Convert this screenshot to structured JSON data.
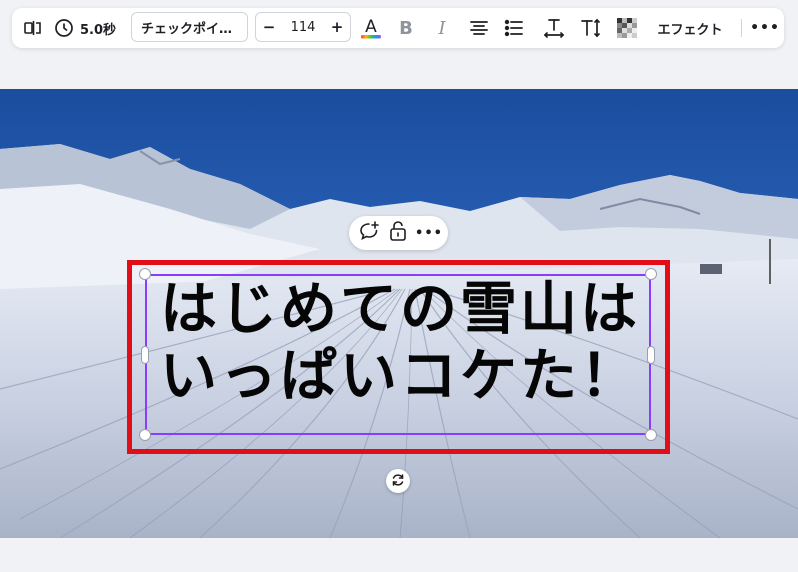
{
  "toolbar": {
    "duration_label": "5.0秒",
    "font_name": "チェックポイ…",
    "font_size": "114",
    "decrease_label": "−",
    "increase_label": "+",
    "text_color_glyph": "A",
    "bold_glyph": "B",
    "italic_glyph": "I",
    "effects_label": "エフェクト",
    "more_label": "•••"
  },
  "icons": {
    "flip": "flip-icon",
    "clock": "clock-icon",
    "text_color": "text-color-icon",
    "bold": "bold-icon",
    "italic": "italic-icon",
    "align": "align-center-icon",
    "list": "list-icon",
    "letter_spacing": "letter-spacing-icon",
    "line_spacing": "line-spacing-icon",
    "transparency": "transparency-icon",
    "comment": "add-comment-icon",
    "lock": "lock-icon",
    "more": "more-icon",
    "rotate": "rotate-icon"
  },
  "canvas": {
    "headline_line1": "はじめての雪山は",
    "headline_line2": "いっぱいコケた！"
  },
  "float_toolbar": {
    "more_label": "•••"
  },
  "colors": {
    "selection": "#8b3dff",
    "frame": "#e10d17",
    "text": "#060606"
  }
}
